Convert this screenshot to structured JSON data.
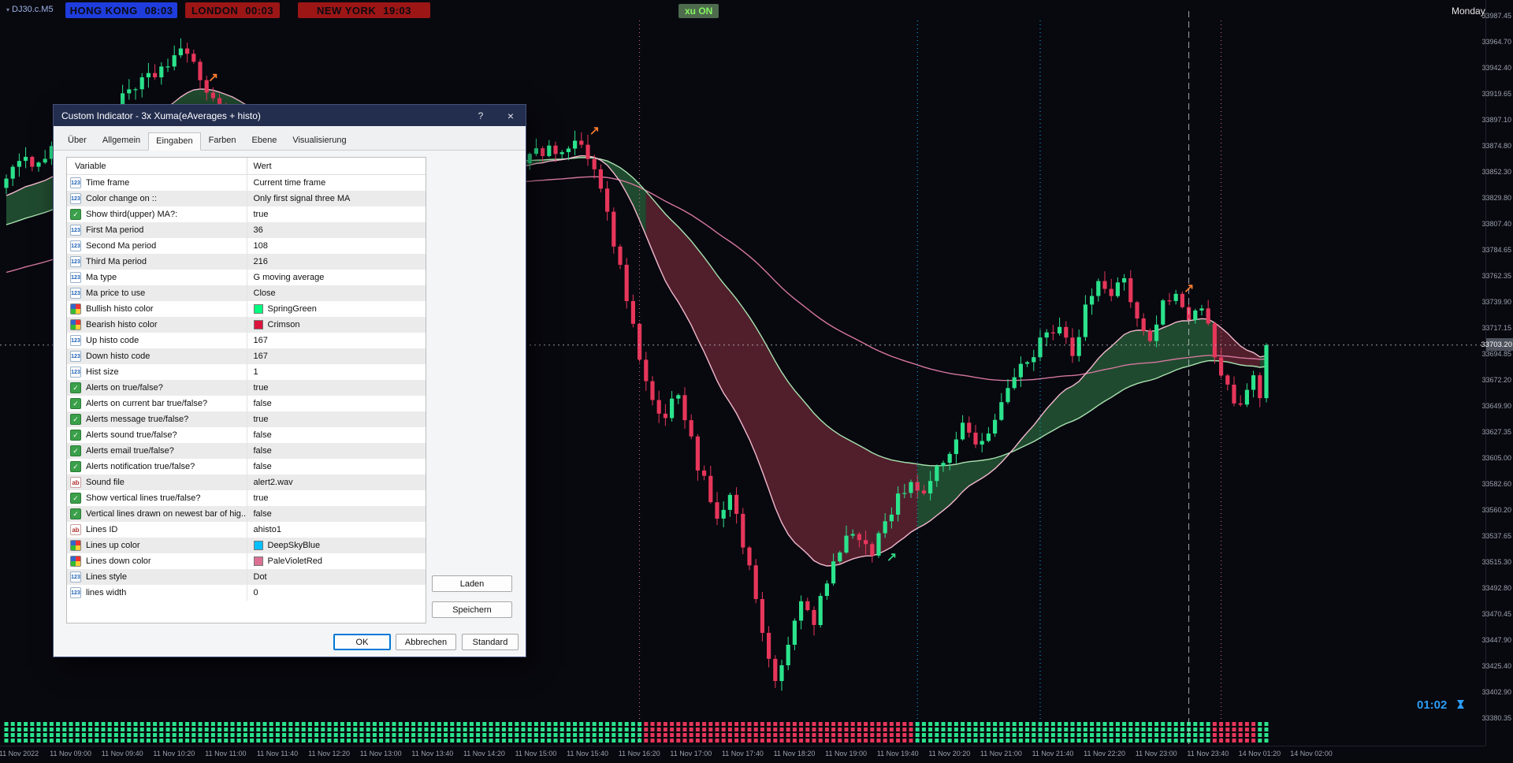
{
  "window": {
    "symbol": "DJ30.c.M5",
    "day_label": "Monday",
    "xu_button": "xu ON",
    "countdown": "01:02"
  },
  "clocks": [
    {
      "city": "HONG KONG",
      "time": "08:03",
      "bg": "#1f3ddd"
    },
    {
      "city": "LONDON",
      "time": "00:03",
      "bg": "#9c1616"
    },
    {
      "city": "NEW YORK",
      "time": "19:03",
      "bg": "#9c1616"
    }
  ],
  "dialog": {
    "title": "Custom Indicator - 3x Xuma(eAverages + histo)",
    "help": "?",
    "close": "×",
    "tabs": [
      "Über",
      "Allgemein",
      "Eingaben",
      "Farben",
      "Ebene",
      "Visualisierung"
    ],
    "active_tab": "Eingaben",
    "headers": [
      "Variable",
      "Wert"
    ],
    "rows": [
      {
        "type": "num",
        "label": "Time frame",
        "value": "Current time frame"
      },
      {
        "type": "num",
        "label": "Color change on ::",
        "value": "Only first signal three MA"
      },
      {
        "type": "bool",
        "label": "Show third(upper) MA?:",
        "value": "true"
      },
      {
        "type": "num",
        "label": "First Ma period",
        "value": "36"
      },
      {
        "type": "num",
        "label": "Second Ma period",
        "value": "108"
      },
      {
        "type": "num",
        "label": "Third Ma period",
        "value": "216"
      },
      {
        "type": "num",
        "label": "Ma type",
        "value": "G moving average"
      },
      {
        "type": "num",
        "label": "Ma price to use",
        "value": "Close"
      },
      {
        "type": "color",
        "label": "Bullish histo color",
        "value": "SpringGreen",
        "swatch": "#00FF7F"
      },
      {
        "type": "color",
        "label": "Bearish histo color",
        "value": "Crimson",
        "swatch": "#DC143C"
      },
      {
        "type": "num",
        "label": "Up histo code",
        "value": "167"
      },
      {
        "type": "num",
        "label": "Down histo code",
        "value": "167"
      },
      {
        "type": "num",
        "label": "Hist size",
        "value": "1"
      },
      {
        "type": "bool",
        "label": "Alerts on true/false?",
        "value": "true"
      },
      {
        "type": "bool",
        "label": "Alerts on current bar true/false?",
        "value": "false"
      },
      {
        "type": "bool",
        "label": "Alerts message true/false?",
        "value": "true"
      },
      {
        "type": "bool",
        "label": "Alerts sound true/false?",
        "value": "false"
      },
      {
        "type": "bool",
        "label": "Alerts email true/false?",
        "value": "false"
      },
      {
        "type": "bool",
        "label": "Alerts notification true/false?",
        "value": "false"
      },
      {
        "type": "str",
        "label": "Sound file",
        "value": "alert2.wav"
      },
      {
        "type": "bool",
        "label": "Show vertical lines true/false?",
        "value": "true"
      },
      {
        "type": "bool",
        "label": "Vertical lines drawn on newest bar of hig...",
        "value": "false"
      },
      {
        "type": "str",
        "label": "Lines ID",
        "value": "ahisto1"
      },
      {
        "type": "color",
        "label": "Lines up color",
        "value": "DeepSkyBlue",
        "swatch": "#00BFFF"
      },
      {
        "type": "color",
        "label": "Lines down color",
        "value": "PaleVioletRed",
        "swatch": "#DB7093"
      },
      {
        "type": "num",
        "label": "Lines style",
        "value": "Dot"
      },
      {
        "type": "num",
        "label": "lines width",
        "value": "0"
      }
    ],
    "buttons": {
      "load": "Laden",
      "save": "Speichern",
      "ok": "OK",
      "cancel": "Abbrechen",
      "default": "Standard"
    }
  },
  "chart_data": {
    "type": "candlestick",
    "symbol": "DJ30.c.M5",
    "timeframe": "M5",
    "current_price": "33703.20",
    "price_axis": [
      "33987.45",
      "33964.70",
      "33942.40",
      "33919.65",
      "33897.10",
      "33874.80",
      "33852.30",
      "33829.80",
      "33807.40",
      "33784.65",
      "33762.35",
      "33739.90",
      "33717.15",
      "33694.85",
      "33672.20",
      "33649.90",
      "33627.35",
      "33605.00",
      "33582.60",
      "33560.20",
      "33537.65",
      "33515.30",
      "33492.80",
      "33470.45",
      "33447.90",
      "33425.40",
      "33402.90",
      "33380.35"
    ],
    "time_axis": [
      "11 Nov 2022",
      "11 Nov 09:00",
      "11 Nov 09:40",
      "11 Nov 10:20",
      "11 Nov 11:00",
      "11 Nov 11:40",
      "11 Nov 12:20",
      "11 Nov 13:00",
      "11 Nov 13:40",
      "11 Nov 14:20",
      "11 Nov 15:00",
      "11 Nov 15:40",
      "11 Nov 16:20",
      "11 Nov 17:00",
      "11 Nov 17:40",
      "11 Nov 18:20",
      "11 Nov 19:00",
      "11 Nov 19:40",
      "11 Nov 20:20",
      "11 Nov 21:00",
      "11 Nov 21:40",
      "11 Nov 22:20",
      "11 Nov 23:00",
      "11 Nov 23:40",
      "14 Nov 01:20",
      "14 Nov 02:00"
    ],
    "bar_count": 196,
    "price_anchors": [
      [
        0,
        33852
      ],
      [
        6,
        33868
      ],
      [
        12,
        33888
      ],
      [
        18,
        33915
      ],
      [
        24,
        33942
      ],
      [
        27,
        33958
      ],
      [
        30,
        33934
      ],
      [
        34,
        33898
      ],
      [
        40,
        33862
      ],
      [
        48,
        33852
      ],
      [
        56,
        33861
      ],
      [
        64,
        33853
      ],
      [
        72,
        33850
      ],
      [
        78,
        33862
      ],
      [
        85,
        33871
      ],
      [
        88,
        33878
      ],
      [
        91,
        33856
      ],
      [
        93,
        33815
      ],
      [
        95,
        33768
      ],
      [
        97,
        33716
      ],
      [
        99,
        33668
      ],
      [
        101,
        33640
      ],
      [
        104,
        33658
      ],
      [
        107,
        33600
      ],
      [
        110,
        33556
      ],
      [
        112,
        33576
      ],
      [
        115,
        33510
      ],
      [
        117,
        33460
      ],
      [
        119,
        33408
      ],
      [
        121,
        33446
      ],
      [
        123,
        33482
      ],
      [
        125,
        33466
      ],
      [
        128,
        33515
      ],
      [
        131,
        33542
      ],
      [
        134,
        33526
      ],
      [
        137,
        33562
      ],
      [
        140,
        33588
      ],
      [
        142,
        33572
      ],
      [
        145,
        33604
      ],
      [
        148,
        33634
      ],
      [
        151,
        33618
      ],
      [
        154,
        33654
      ],
      [
        157,
        33684
      ],
      [
        160,
        33704
      ],
      [
        163,
        33724
      ],
      [
        165,
        33698
      ],
      [
        167,
        33734
      ],
      [
        169,
        33757
      ],
      [
        171,
        33744
      ],
      [
        173,
        33764
      ],
      [
        175,
        33724
      ],
      [
        177,
        33702
      ],
      [
        179,
        33738
      ],
      [
        181,
        33750
      ],
      [
        183,
        33728
      ],
      [
        185,
        33740
      ],
      [
        187,
        33694
      ],
      [
        189,
        33664
      ],
      [
        191,
        33652
      ],
      [
        193,
        33674
      ],
      [
        194,
        33656
      ],
      [
        195,
        33703
      ]
    ],
    "trend_segments": [
      {
        "to": 99,
        "dir": "up"
      },
      {
        "to": 141,
        "dir": "down"
      },
      {
        "to": 187,
        "dir": "up"
      },
      {
        "to": 194,
        "dir": "down"
      },
      {
        "to": 196,
        "dir": "up"
      }
    ],
    "signal_lines": [
      {
        "bar": 98,
        "dir": "down"
      },
      {
        "bar": 141,
        "dir": "up"
      },
      {
        "bar": 160,
        "dir": "up"
      },
      {
        "bar": 188,
        "dir": "down"
      }
    ],
    "session_break_bar": 183,
    "arrows": [
      {
        "bar": 32,
        "price": 33934,
        "dir": "sell"
      },
      {
        "bar": 91,
        "price": 33888,
        "dir": "sell"
      },
      {
        "bar": 137,
        "price": 33520,
        "dir": "buy"
      },
      {
        "bar": 183,
        "price": 33752,
        "dir": "sell"
      }
    ],
    "colors": {
      "bull": "#2be38c",
      "bear": "#e6365a",
      "ribbon_up": "#235233",
      "ribbon_down": "#5a2230",
      "ma_fast": "#f3b9ce",
      "ma_slow": "#a9e3b0",
      "ma_third": "#d5789f",
      "line_up": "#00BFFF",
      "line_down": "#DB7093"
    }
  }
}
